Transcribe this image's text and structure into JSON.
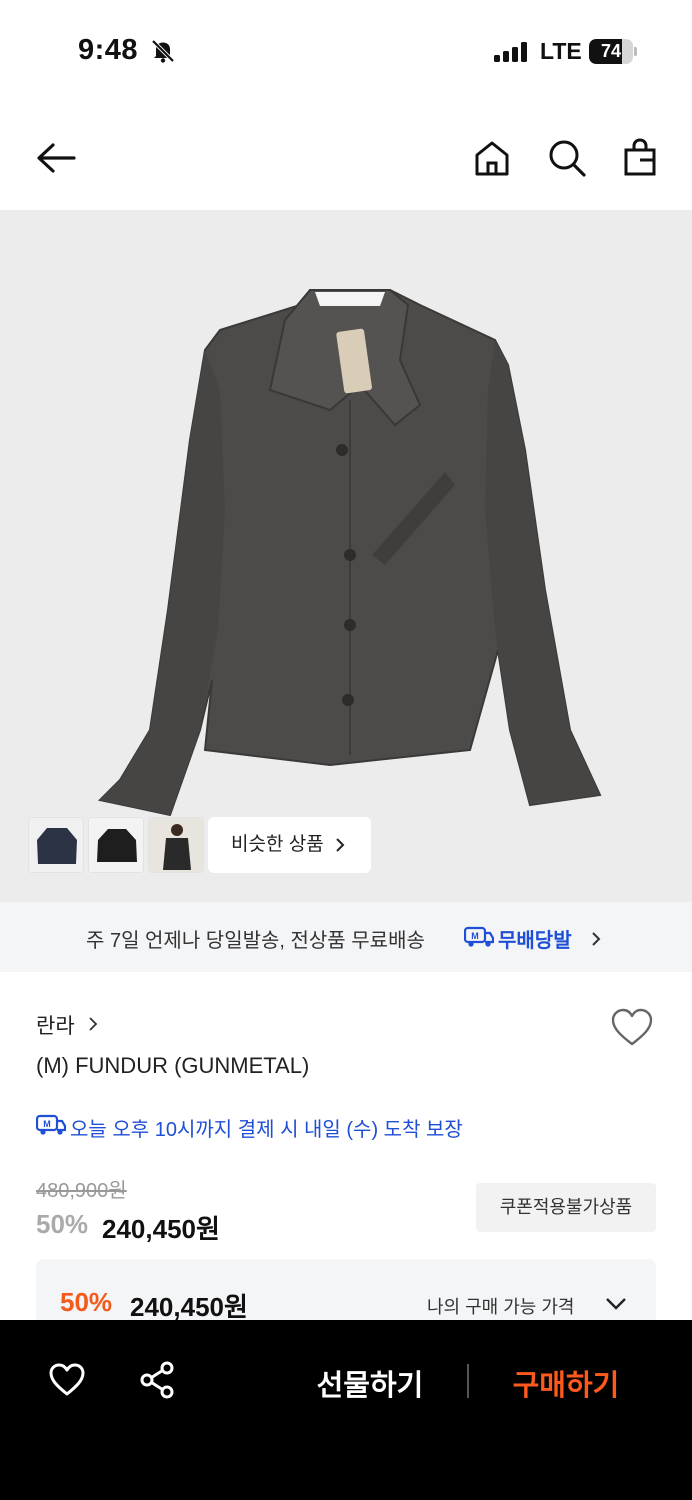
{
  "status_bar": {
    "time": "9:48",
    "network": "LTE",
    "battery": "74",
    "battery_level": 0.74
  },
  "header": {
    "icons": [
      "back-arrow-icon",
      "home-icon",
      "search-icon",
      "shopping-bag-icon"
    ]
  },
  "gallery": {
    "thumbnails": [
      "navy-jacket-thumbnail",
      "black-jacket-thumbnail",
      "model-wearing-thumbnail"
    ],
    "similar_label": "비슷한 상품"
  },
  "delivery_banner": {
    "text": "주 7일 언제나 당일발송, 전상품 무료배송",
    "badge": "무배당발"
  },
  "product": {
    "brand": "란라",
    "name": "(M) FUNDUR (GUNMETAL)",
    "arrival_notice": "오늘 오후 10시까지 결제 시 내일 (수) 도착 보장",
    "original_price": "480,900원",
    "discount_rate": "50%",
    "sale_price": "240,450원",
    "coupon_badge": "쿠폰적용불가상품"
  },
  "my_price": {
    "rate": "50%",
    "price": "240,450원",
    "label": "나의 구매 가능 가격"
  },
  "bottom_bar": {
    "gift_label": "선물하기",
    "buy_label": "구매하기"
  },
  "colors": {
    "accent": "#ff5a1c",
    "link_blue": "#1f4fd6",
    "garment": "#4d4b4a"
  }
}
